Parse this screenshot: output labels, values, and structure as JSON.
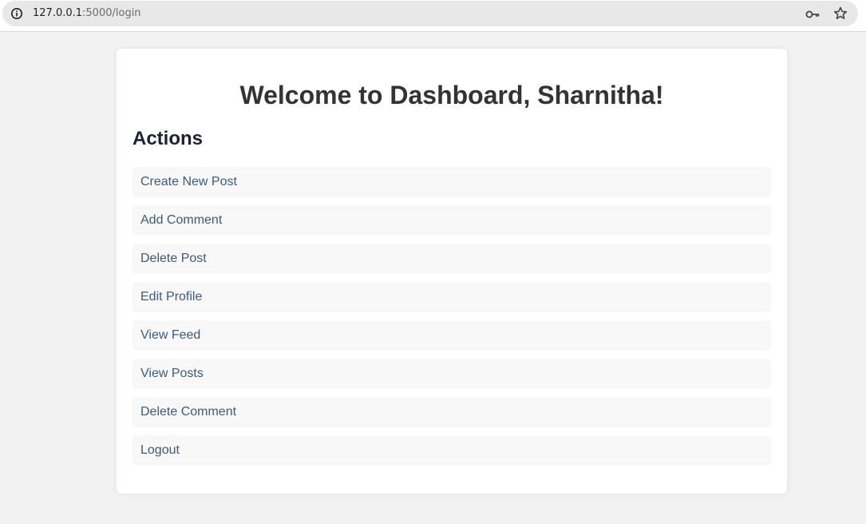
{
  "browser": {
    "url_host": "127.0.0.1",
    "url_path": ":5000/login",
    "icons": [
      "info-icon",
      "key-icon",
      "star-icon"
    ]
  },
  "page": {
    "title": "Welcome to Dashboard, Sharnitha!",
    "section_heading": "Actions",
    "actions": [
      {
        "label": "Create New Post"
      },
      {
        "label": "Add Comment"
      },
      {
        "label": "Delete Post"
      },
      {
        "label": "Edit Profile"
      },
      {
        "label": "View Feed"
      },
      {
        "label": "View Posts"
      },
      {
        "label": "Delete Comment"
      },
      {
        "label": "Logout"
      }
    ]
  },
  "colors": {
    "background": "#f2f2f2",
    "card": "#ffffff",
    "title": "#333333",
    "link": "#3d5a80",
    "item_background": "#f8f8f8"
  }
}
